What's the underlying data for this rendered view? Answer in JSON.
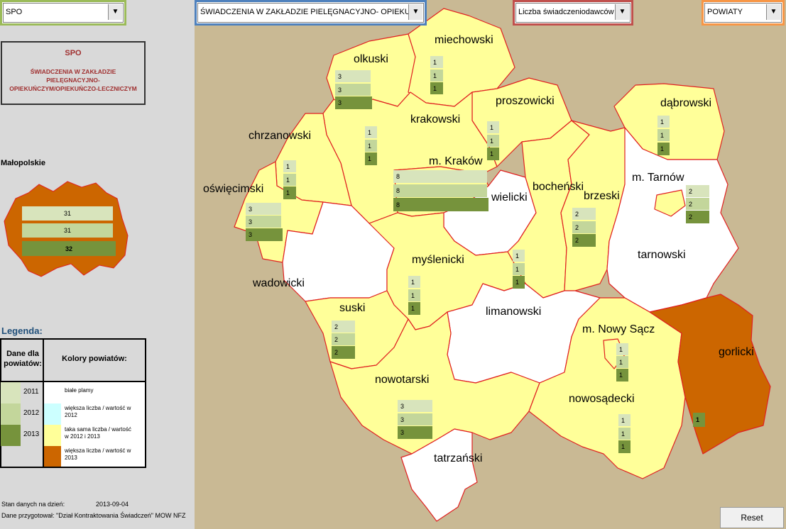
{
  "dropdowns": {
    "type": "SPO",
    "service": "ŚWIADCZENIA W  ZAKŁADZIE PIELĘGNACYJNO- OPIEKUŃC",
    "metric": "Liczba świadczeniodawców",
    "level": "POWIATY"
  },
  "info_box": {
    "title": "SPO",
    "desc_line1": "ŚWIADCZENIA W  ZAKŁADZIE",
    "desc_line2": "PIELĘGNACYJNO-",
    "desc_line3": "OPIEKUŃCZYM/OPIEKUŃCZO-LECZNICZYM"
  },
  "region": {
    "label": "Małopolskie",
    "values": [
      "31",
      "31",
      "32"
    ]
  },
  "legend": {
    "title": "Legenda:",
    "data_header_l1": "Dane dla",
    "data_header_l2": "powiatów:",
    "colors_header": "Kolory powiatów:",
    "years": [
      "2011",
      "2012",
      "2013"
    ],
    "items": [
      {
        "l1": "białe plamy",
        "l2": ""
      },
      {
        "l1": "większa liczba / wartość w",
        "l2": "2012"
      },
      {
        "l1": "taka sama liczba / wartość",
        "l2": "w 2012 i 2013"
      },
      {
        "l1": "większa liczba / wartość w",
        "l2": "2013"
      }
    ]
  },
  "status": {
    "date_label": "Stan danych na dzień:",
    "date_value": "2013-09-04",
    "prepared": "Dane przygotował: \"Dział Kontraktowania Świadczeń\" MOW NFZ"
  },
  "reset_label": "Reset",
  "colors": {
    "white_spot": "#ffffff",
    "more_2012": "#ccffff",
    "same": "#ffff99",
    "more_2013": "#cc6600",
    "bar_2011": "#d8e4bc",
    "bar_2012": "#c3d69b",
    "bar_2013": "#76933c"
  },
  "districts": {
    "miechowski": {
      "name": "miechowski",
      "v": [
        "1",
        "1",
        "1"
      ]
    },
    "olkuski": {
      "name": "olkuski",
      "v": [
        "3",
        "3",
        "3"
      ]
    },
    "proszowicki": {
      "name": "proszowicki",
      "v": [
        "1",
        "1",
        "1"
      ]
    },
    "krakowski": {
      "name": "krakowski",
      "v": [
        "1",
        "1",
        "1"
      ]
    },
    "dabrowski": {
      "name": "dąbrowski",
      "v": [
        "1",
        "1",
        "1"
      ]
    },
    "chrzanowski": {
      "name": "chrzanowski",
      "v": [
        "1",
        "1",
        "1"
      ]
    },
    "mkrakow": {
      "name": "m. Kraków",
      "v": [
        "8",
        "8",
        "8"
      ]
    },
    "mtarnow": {
      "name": "m. Tarnów",
      "v": [
        "2",
        "2",
        "2"
      ]
    },
    "oswiecimski": {
      "name": "oświęcimski",
      "v": [
        "3",
        "3",
        "3"
      ]
    },
    "wielicki": {
      "name": "wielicki",
      "v": []
    },
    "bochenski": {
      "name": "bocheński",
      "v": [
        "1",
        "1",
        "1"
      ]
    },
    "brzeski": {
      "name": "brzeski",
      "v": [
        "2",
        "2",
        "2"
      ]
    },
    "tarnowski": {
      "name": "tarnowski",
      "v": []
    },
    "wadowicki": {
      "name": "wadowicki",
      "v": []
    },
    "myslenicki": {
      "name": "myślenicki",
      "v": [
        "1",
        "1",
        "1"
      ]
    },
    "limanowski": {
      "name": "limanowski",
      "v": []
    },
    "suski": {
      "name": "suski",
      "v": [
        "2",
        "2",
        "2"
      ]
    },
    "mnowysacz": {
      "name": "m. Nowy Sącz",
      "v": [
        "1",
        "1",
        "1"
      ]
    },
    "gorlicki": {
      "name": "gorlicki",
      "v": [
        "",
        "",
        "1"
      ]
    },
    "nowotarski": {
      "name": "nowotarski",
      "v": [
        "3",
        "3",
        "3"
      ]
    },
    "nowosadecki": {
      "name": "nowosądecki",
      "v": [
        "1",
        "1",
        "1"
      ]
    },
    "tatrzanski": {
      "name": "tatrzański",
      "v": []
    }
  }
}
